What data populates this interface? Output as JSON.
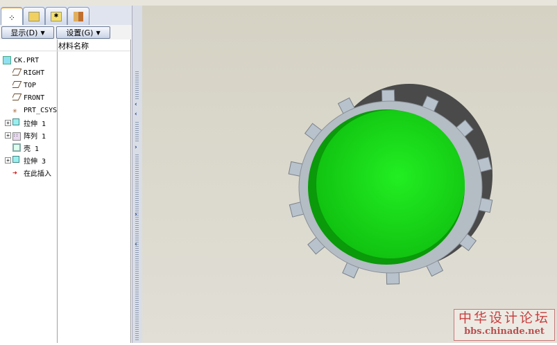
{
  "tabs": [
    {
      "name": "model-tree",
      "icon": "tree-icon"
    },
    {
      "name": "layers",
      "icon": "layers-icon"
    },
    {
      "name": "folder",
      "icon": "folder-icon"
    },
    {
      "name": "favorites",
      "icon": "tools-icon"
    }
  ],
  "buttons": {
    "show": "显示(D)",
    "settings": "设置(G)"
  },
  "column_header": "材料名称",
  "tree": [
    {
      "label": "CK.PRT",
      "icon": "part-icon",
      "expand": false
    },
    {
      "label": "RIGHT",
      "icon": "datum-plane-icon",
      "expand": false
    },
    {
      "label": "TOP",
      "icon": "datum-plane-icon",
      "expand": false
    },
    {
      "label": "FRONT",
      "icon": "datum-plane-icon",
      "expand": false
    },
    {
      "label": "PRT_CSYS",
      "icon": "csys-icon",
      "expand": false
    },
    {
      "label": "拉伸 1",
      "icon": "extrude-icon",
      "expand": true
    },
    {
      "label": "阵列 1",
      "icon": "pattern-icon",
      "expand": true
    },
    {
      "label": "壳 1",
      "icon": "shell-icon",
      "expand": false
    },
    {
      "label": "拉伸 3",
      "icon": "extrude-icon",
      "expand": true
    },
    {
      "label": "在此插入",
      "icon": "insert-arrow-icon",
      "expand": false
    }
  ],
  "watermark": {
    "title": "中华设计论坛",
    "url": "bbs.chinade.net"
  },
  "colors": {
    "green": "#22ee22",
    "gear": "#b4bcc4",
    "gear_side": "#4a4a4a"
  }
}
